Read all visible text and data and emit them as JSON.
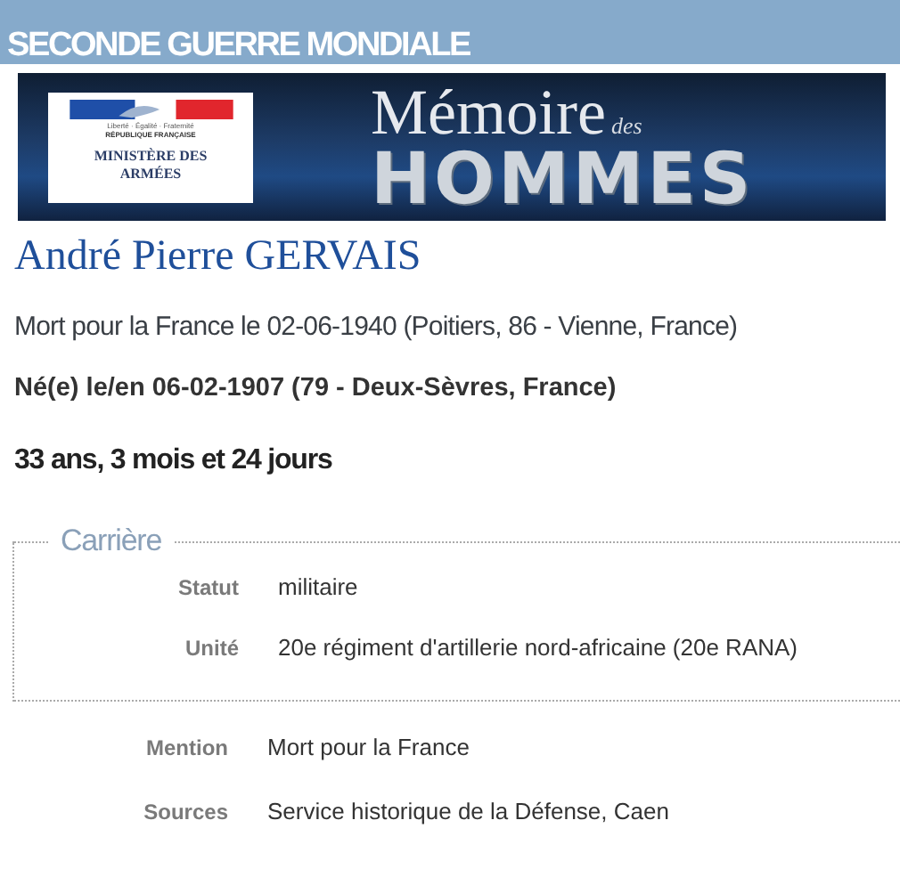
{
  "header": {
    "title": "SECONDE GUERRE MONDIALE"
  },
  "banner": {
    "motto": "Liberté · Égalité · Fraternité",
    "republic": "RÉPUBLIQUE FRANÇAISE",
    "ministry": "MINISTÈRE DES ARMÉES",
    "title": "Mémoire",
    "title_small": "des",
    "title_large": "HOMMES"
  },
  "person": {
    "name": "André Pierre GERVAIS",
    "death": "Mort pour la France le 02-06-1940 (Poitiers, 86 - Vienne, France)",
    "birth": "Né(e) le/en 06-02-1907 (79 - Deux-Sèvres, France)",
    "age": "33 ans, 3 mois et 24 jours"
  },
  "career": {
    "legend": "Carrière",
    "fields": [
      {
        "label": "Statut",
        "value": "militaire"
      },
      {
        "label": "Unité",
        "value": "20e régiment d'artillerie nord-africaine (20e RANA)"
      }
    ]
  },
  "details": [
    {
      "label": "Mention",
      "value": "Mort pour la France"
    },
    {
      "label": "Sources",
      "value": "Service historique de la Défense, Caen"
    }
  ]
}
